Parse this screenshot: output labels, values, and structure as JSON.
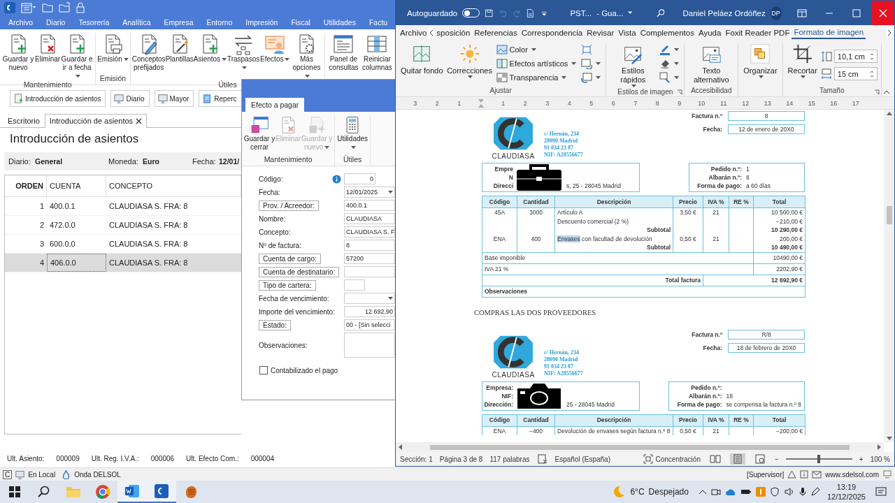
{
  "left_app": {
    "menu": [
      "Archivo",
      "Diario",
      "Tesorería",
      "Analítica",
      "Empresa",
      "Entorno",
      "Impresión",
      "Fiscal",
      "Utilidades",
      "Factu"
    ],
    "ribbon_groups": [
      {
        "label": "Mantenimiento",
        "buttons": [
          {
            "label": "Guardar y nuevo",
            "kind": "doc-plus"
          },
          {
            "label": "Eliminar",
            "kind": "doc-x"
          },
          {
            "label": "Guardar e ir a fecha",
            "kind": "doc-plus",
            "dropdown": true
          }
        ]
      },
      {
        "label": "Emisión",
        "buttons": [
          {
            "label": "Emisión",
            "kind": "printer",
            "dropdown": true
          }
        ]
      },
      {
        "label": "Útiles",
        "buttons": [
          {
            "label": "Conceptos prefijados",
            "kind": "doc-pen"
          },
          {
            "label": "Plantillas",
            "kind": "doc-wand"
          },
          {
            "label": "Asientos",
            "kind": "doc-plus",
            "dropdown": true
          },
          {
            "label": "Traspasos",
            "kind": "arrows",
            "dropdown": true
          },
          {
            "label": "Efectos",
            "kind": "card",
            "dropdown": true
          },
          {
            "label": "Más opciones",
            "kind": "doc-gear",
            "dropdown": true
          }
        ]
      },
      {
        "buttons": [
          {
            "label": "Panel de consultas",
            "kind": "panel"
          },
          {
            "label": "Reiniciar columnas",
            "kind": "columns"
          }
        ]
      }
    ],
    "shortcuts": [
      {
        "label": "Introducción de asientos",
        "kind": "entry"
      },
      {
        "label": "Diario",
        "kind": "monitor"
      },
      {
        "label": "Mayor",
        "kind": "monitor"
      },
      {
        "label": "Reperc",
        "kind": "clipboard"
      }
    ],
    "doc_tabs": [
      {
        "label": "Escritorio",
        "selected": false
      },
      {
        "label": "Introducción de asientos",
        "selected": true
      }
    ],
    "page_title": "Introducción de asientos",
    "header_fields": [
      {
        "label": "Diario:",
        "value": "General"
      },
      {
        "label": "Moneda:",
        "value": "Euro"
      },
      {
        "label": "Fecha:",
        "value": "12/01/"
      }
    ],
    "table": {
      "columns": [
        "ORDEN",
        "CUENTA",
        "CONCEPTO"
      ],
      "rows": [
        {
          "cells": [
            "1",
            "400.0.1",
            "CLAUDIASA S. FRA:  8"
          ],
          "selected": false
        },
        {
          "cells": [
            "2",
            "472.0.0",
            "CLAUDIASA S. FRA:  8"
          ],
          "selected": false
        },
        {
          "cells": [
            "3",
            "600.0.0",
            "CLAUDIASA S. FRA:  8"
          ],
          "selected": false
        },
        {
          "cells": [
            "4",
            "406.0.0",
            "CLAUDIASA S. FRA:  8"
          ],
          "selected": true
        }
      ]
    },
    "status": [
      {
        "label": "Ult. Asiento:",
        "value": "000009"
      },
      {
        "label": "Ult. Reg. I.V.A.:",
        "value": "000006"
      },
      {
        "label": "Ult. Efecto Com.:",
        "value": "000004"
      }
    ],
    "bottom_bar": {
      "key": "C",
      "items": [
        {
          "label": "En Local",
          "kind": "monitor"
        },
        {
          "label": "Onda DELSOL",
          "kind": "drop"
        }
      ],
      "user": "[Supervisor]",
      "website": "www.sdelsol.com"
    }
  },
  "dialog": {
    "tab": "Efecto a pagar",
    "ribbon_groups": [
      {
        "label": "Mantenimiento",
        "buttons": [
          {
            "label": "Guardar y cerrar",
            "kind": "save",
            "disabled": false
          },
          {
            "label": "Eliminar",
            "kind": "doc-x",
            "disabled": true
          },
          {
            "label": "Guardar y nuevo",
            "kind": "save-plus",
            "disabled": true,
            "dropdown": true
          }
        ]
      },
      {
        "label": "Útiles",
        "buttons": [
          {
            "label": "Utilidades",
            "kind": "calculator",
            "disabled": false,
            "dropdown": true
          }
        ]
      }
    ],
    "fields": [
      {
        "label": "Código:",
        "kind": "short",
        "value": "0",
        "info": true
      },
      {
        "label": "Fecha:",
        "kind": "select",
        "value": "12/01/2025"
      },
      {
        "label": "Prov. / Acreedor:",
        "kind": "lookup",
        "value": "400.0.1"
      },
      {
        "label": "Nombre:",
        "kind": "text",
        "value": "CLAUDIASA"
      },
      {
        "label": "Concepto:",
        "kind": "text",
        "value": "CLAUDIASA S. F"
      },
      {
        "label": "Nº de factura:",
        "kind": "text",
        "value": "8"
      },
      {
        "label": "Cuenta de cargo:",
        "kind": "lookup",
        "value": "57200"
      },
      {
        "label": "Cuenta de destinatario:",
        "kind": "lookup"
      },
      {
        "label": "Tipo de cartera:",
        "kind": "lookup-tiny"
      },
      {
        "label": "Fecha de vencimiento:",
        "kind": "select"
      },
      {
        "label": "Importe del vencimiento:",
        "kind": "number",
        "value": "12.692,90"
      },
      {
        "label": "Estado:",
        "kind": "lookup",
        "value": "00 - [Sin selecci"
      },
      {
        "label": "Observaciones:",
        "kind": "area"
      }
    ],
    "checkbox": {
      "label": "Contabilizado el pago",
      "checked": false
    }
  },
  "word": {
    "title_bar": {
      "autosave_label": "Autoguardado",
      "autosave_on": false,
      "doc_name": "PST...",
      "doc_status": "- Gua...",
      "user": "Daniel Peláez Ordóñez",
      "initials": "DP"
    },
    "tabs": [
      {
        "label": "Archivo",
        "selected": false
      },
      {
        "label": "sposición",
        "selected": false
      },
      {
        "label": "Referencias",
        "selected": false
      },
      {
        "label": "Correspondencia",
        "selected": false
      },
      {
        "label": "Revisar",
        "selected": false
      },
      {
        "label": "Vista",
        "selected": false
      },
      {
        "label": "Complementos",
        "selected": false
      },
      {
        "label": "Ayuda",
        "selected": false
      },
      {
        "label": "Foxit Reader PDF",
        "selected": false
      },
      {
        "label": "Formato de imagen",
        "selected": true
      }
    ],
    "ribbon_groups": [
      {
        "label": "Ajustar",
        "large": [
          {
            "label": "Quitar fondo",
            "kind": "remove-bg"
          },
          {
            "label": "Correcciones",
            "kind": "sun",
            "dropdown": true
          }
        ],
        "small": [
          {
            "label": "Color",
            "kind": "color",
            "dropdown": true
          },
          {
            "label": "Efectos artísticos",
            "kind": "effects",
            "dropdown": true
          },
          {
            "label": "Transparencia",
            "kind": "transparency",
            "dropdown": true
          }
        ],
        "icons": [
          {
            "kind": "compress"
          },
          {
            "kind": "change",
            "dropdown": true
          },
          {
            "kind": "reset",
            "dropdown": true
          }
        ]
      },
      {
        "label": "Estilos de imagen",
        "large": [
          {
            "label": "Estilos rápidos",
            "kind": "styles",
            "dropdown": true
          }
        ],
        "icons": [
          {
            "kind": "border",
            "dropdown": true
          },
          {
            "kind": "effect2",
            "dropdown": true
          },
          {
            "kind": "layout",
            "dropdown": true
          }
        ],
        "launcher": true
      },
      {
        "label": "Accesibilidad",
        "large": [
          {
            "label": "Texto alternativo",
            "kind": "alt-text"
          }
        ]
      },
      {
        "large": [
          {
            "label": "Organizar",
            "kind": "organize",
            "dropdown": true
          }
        ]
      },
      {
        "label": "Tamaño",
        "large": [
          {
            "label": "Recortar",
            "kind": "crop",
            "dropdown": true
          }
        ],
        "sizes": [
          {
            "kind": "height",
            "value": "10,1 cm"
          },
          {
            "kind": "width",
            "value": "15 cm"
          }
        ],
        "launcher": true
      }
    ],
    "ruler": {
      "before": [
        "3",
        "2",
        "1"
      ],
      "after": [
        "1",
        "2",
        "3",
        "4",
        "5",
        "6",
        "7",
        "8",
        "9",
        "10",
        "11",
        "12",
        "13",
        "14",
        "15",
        "16",
        "17"
      ]
    },
    "invoices": [
      {
        "kind": "briefcase",
        "number_label": "Factura n.º",
        "number": "8",
        "date_label": "Fecha:",
        "date": "12 de enero de 20X0",
        "logo_text": "CLAUDIASA",
        "address": [
          "c/ Hernán, 234",
          "28090 Madrid",
          "91 034 23 87",
          "NIF: A28556677"
        ],
        "client": [
          {
            "label": "Empre"
          },
          {
            "label": "N"
          },
          {
            "label": "Direcci",
            "value": "s, 25 - 28045 Madrid"
          }
        ],
        "order": [
          {
            "label": "Pedido n.º:",
            "value": "1"
          },
          {
            "label": "Albarán n.º:",
            "value": "8"
          },
          {
            "label": "Forma de pago:",
            "value": "a 60 días"
          }
        ],
        "columns": [
          "Código",
          "Cantidad",
          "Descripción",
          "Precio",
          "IVA %",
          "RE %",
          "Total"
        ],
        "rows": [
          {
            "kind": "item",
            "cells": [
              "45A",
              "3000",
              "Artículo A",
              "3,50 €",
              "21",
              null,
              "10 500,00 €"
            ]
          },
          {
            "kind": "item",
            "cells": [
              null,
              null,
              "Descuento comercial (2 %)",
              null,
              null,
              null,
              "−210,00 €"
            ]
          },
          {
            "kind": "subtotal",
            "label": "Subtotal",
            "value": "10 290,00 €"
          },
          {
            "kind": "item",
            "cells": [
              "ENA",
              "400",
              {
                "highlighted": "Envases",
                "text": "con facultad de devolución"
              },
              "0,50 €",
              "21",
              null,
              "200,00 €"
            ]
          },
          {
            "kind": "subtotal",
            "label": "Subtotal",
            "value": "10 490,00 €"
          },
          {
            "kind": "summary",
            "label": "Base imponible",
            "value": "10490,00 €"
          },
          {
            "kind": "summary",
            "label": "IVA 21 %",
            "value": "2202,90 €"
          },
          {
            "kind": "total",
            "label": "Total factura",
            "value": "12 692,90 €"
          },
          {
            "kind": "note",
            "label": "Observaciones"
          }
        ]
      },
      {
        "kind": "camera",
        "heading": "COMPRAS LAS DOS PROVEEDORES",
        "number_label": "Factura n.º",
        "number": "R/8",
        "date_label": "Fecha:",
        "date": "18 de febrero de 20X0",
        "logo_text": "CLAUDIASA",
        "address": [
          "c/ Hernán, 234",
          "28090 Madrid",
          "91 034 23 87",
          "NIF: A28556677"
        ],
        "client": [
          {
            "label": "Empresa:"
          },
          {
            "label": "NIF:"
          },
          {
            "label": "Dirección:",
            "value": "25 - 28045 Madrid"
          }
        ],
        "order": [
          {
            "label": "Pedido n.º:"
          },
          {
            "label": "Albarán n.º:",
            "value": "18"
          },
          {
            "label": "Forma de pago:",
            "value": "se compensa la factura n.º 8"
          }
        ],
        "columns": [
          "Código",
          "Cantidad",
          "Descripción",
          "Precio",
          "IVA %",
          "RE %",
          "Total"
        ],
        "rows": [
          {
            "kind": "item",
            "cells": [
              "ENA",
              "−400",
              "Devolución de envases según factura n.º 8",
              "0,50 €",
              "21",
              null,
              "−200,00 €"
            ]
          }
        ]
      }
    ],
    "status_bar": {
      "section": "Sección: 1",
      "page": "Página 3 de 8",
      "words": "117 palabras",
      "language": "Español (España)",
      "focus": "Concentración",
      "zoom_out": "−",
      "zoom_in": "+",
      "level": 0.5,
      "zoom": "100 %"
    }
  },
  "taskbar": {
    "apps": [
      {
        "kind": "folder",
        "active": false
      },
      {
        "kind": "chrome",
        "active": false
      },
      {
        "kind": "word",
        "active": true
      },
      {
        "kind": "cs",
        "active": true
      },
      {
        "kind": "glove",
        "active": false
      }
    ],
    "temperature": "6°C",
    "weather": "Despejado",
    "time": "13:19",
    "date": "12/12/2025"
  }
}
